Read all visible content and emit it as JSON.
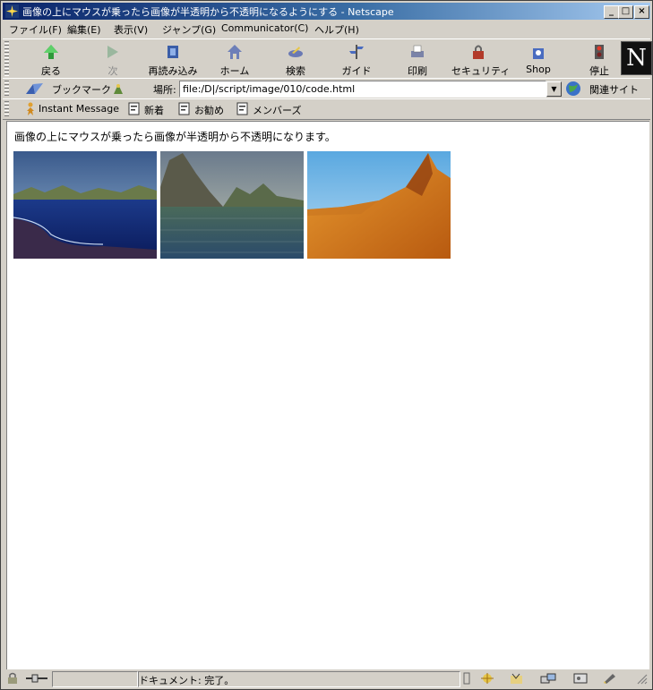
{
  "window": {
    "title": "画像の上にマウスが乗ったら画像が半透明から不透明になるようにする - Netscape",
    "controls": [
      "_",
      "□",
      "×"
    ]
  },
  "menu": [
    "ファイル(F)",
    "編集(E)",
    "表示(V)",
    "ジャンプ(G)",
    "Communicator(C)",
    "ヘルプ(H)"
  ],
  "nav": {
    "back": "戻る",
    "forward": "次",
    "reload": "再読み込み",
    "home": "ホーム",
    "search": "検索",
    "guide": "ガイド",
    "print": "印刷",
    "security": "セキュリティ",
    "shop": "Shop",
    "stop": "停止",
    "logo": "N"
  },
  "location": {
    "bookmarks": "ブックマーク",
    "label": "場所:",
    "url": "file:/D|/script/image/010/code.html",
    "related": "関連サイト"
  },
  "personal": {
    "instant_message": "Instant Message",
    "new": "新着",
    "recommend": "お勧め",
    "members": "メンバーズ"
  },
  "page": {
    "message": "画像の上にマウスが乗ったら画像が半透明から不透明になります。"
  },
  "status": {
    "text": "ドキュメント: 完了。"
  },
  "colors": {
    "title_start": "#0a246a",
    "title_end": "#a6caf0",
    "chrome": "#d4d0c8"
  }
}
